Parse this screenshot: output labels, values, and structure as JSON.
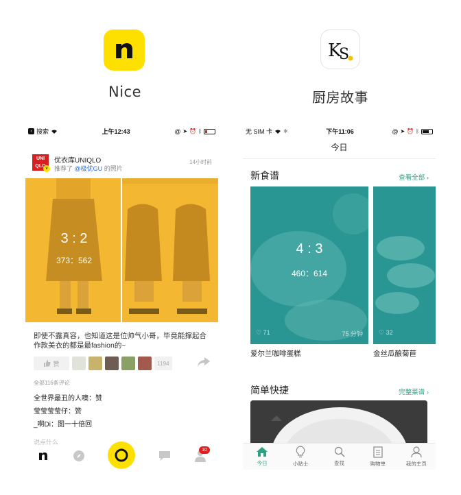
{
  "apps": {
    "nice": {
      "name": "Nice",
      "icon_letter": "n",
      "color": "#fde000"
    },
    "ks": {
      "name": "厨房故事",
      "icon_letters": "KS",
      "accent": "#f5c400"
    }
  },
  "left_screen": {
    "status": {
      "back_label": "搜索",
      "time": "上午12:43"
    },
    "post": {
      "logo_text_1": "UNI",
      "logo_text_2": "QLO",
      "badge": "v",
      "user": "优衣库UNIQLO",
      "recommend_prefix": "推荐了",
      "recommend_link": "@极优GU",
      "recommend_suffix": "的照片",
      "time": "14小时前",
      "ratio": "3 : 2",
      "size": "373：562",
      "caption": "即使不露真容，也知道这是位帅气小哥，毕竟能撑起合作款美衣的都是最fashion的~",
      "like_label": "赞",
      "like_count": "1194",
      "comments_label": "全部116条评论",
      "comments": [
        {
          "user": "全世界最丑的人噢",
          "text": "赞"
        },
        {
          "user": "莹莹莹莹仔",
          "text": "赞"
        },
        {
          "user": "_啊Di",
          "text": "图一十倍回"
        }
      ],
      "comment_placeholder": "说点什么"
    },
    "tabbar": {
      "profile_badge": "10"
    }
  },
  "right_screen": {
    "status": {
      "carrier": "无 SIM 卡",
      "time": "下午11:06"
    },
    "nav_title": "今日",
    "new_recipes": {
      "title": "新食谱",
      "more": "查看全部 ›",
      "cards": [
        {
          "name": "爱尔兰咖啡蛋糕",
          "ratio": "4 : 3",
          "size": "460：614",
          "likes": "71",
          "duration": "75 分钟"
        },
        {
          "name": "金丝瓜酿菊苣",
          "likes": "32"
        }
      ]
    },
    "quick": {
      "title": "简单快捷",
      "more": "完整菜谱 ›"
    },
    "tabs": [
      {
        "label": "今日",
        "icon": "home-icon",
        "active": true
      },
      {
        "label": "小贴士",
        "icon": "bulb-icon",
        "active": false
      },
      {
        "label": "查找",
        "icon": "search-icon",
        "active": false
      },
      {
        "label": "购物单",
        "icon": "list-icon",
        "active": false
      },
      {
        "label": "我的主页",
        "icon": "person-icon",
        "active": false
      }
    ],
    "accent": "#2fa183"
  }
}
